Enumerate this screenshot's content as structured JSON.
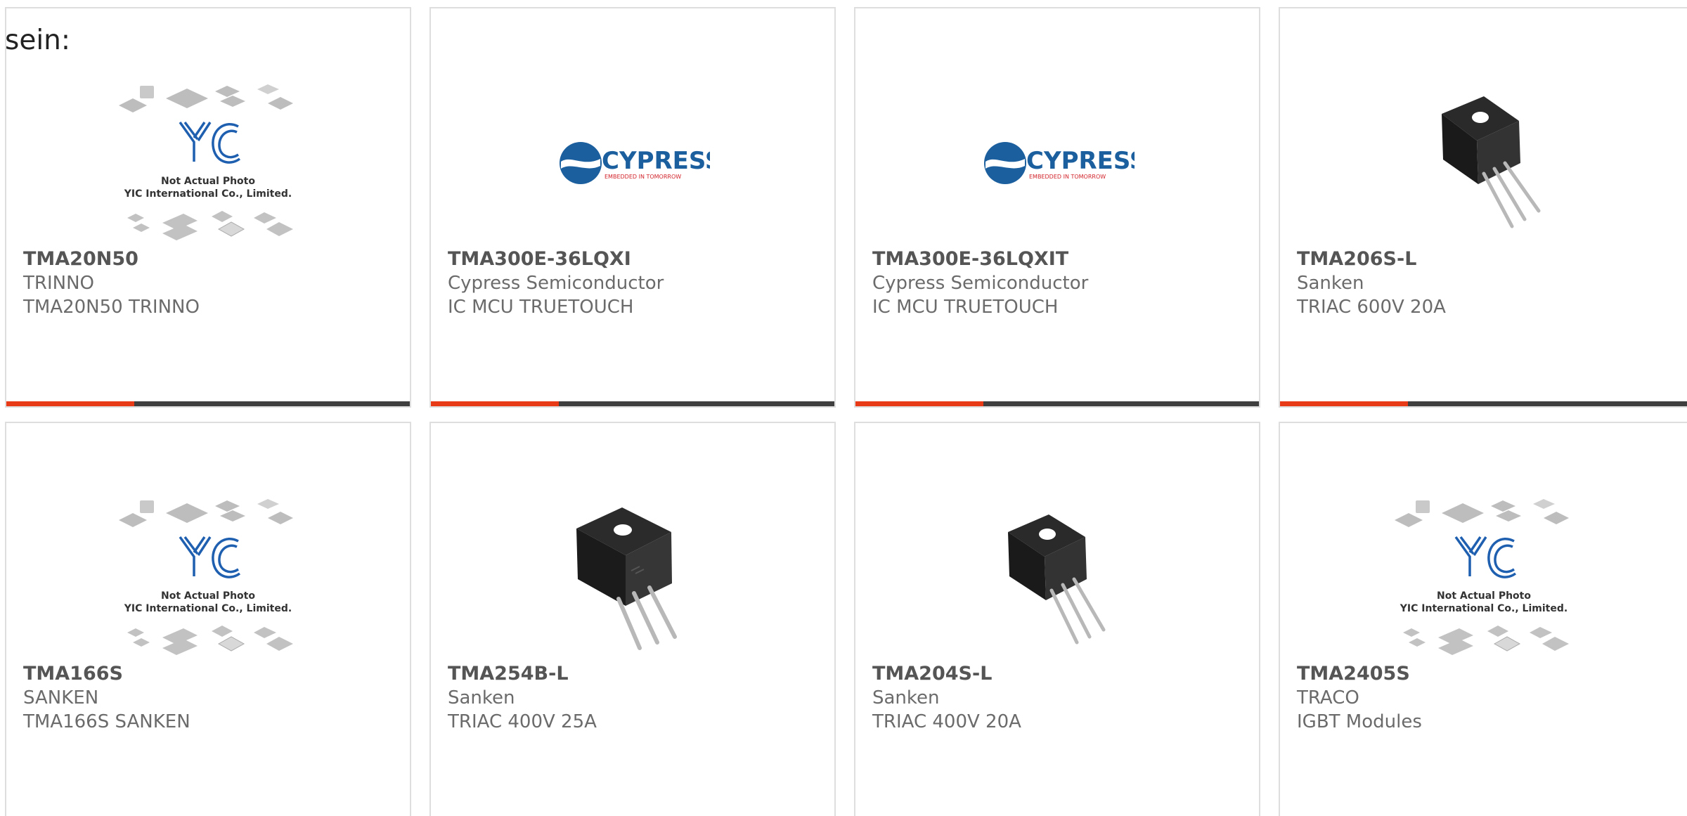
{
  "page": {
    "cut_text": "sein:"
  },
  "products": [
    {
      "part": "TMA20N50",
      "maker": "TRINNO",
      "desc": "TMA20N50 TRINNO",
      "image": "yic-placeholder",
      "image_text_line1": "Not Actual Photo",
      "image_text_line2": "YIC International Co., Limited."
    },
    {
      "part": "TMA300E-36LQXI",
      "maker": "Cypress Semiconductor",
      "desc": "IC MCU TRUETOUCH",
      "image": "cypress-logo",
      "logo_text": "CYPRESS",
      "logo_tagline": "EMBEDDED IN TOMORROW"
    },
    {
      "part": "TMA300E-36LQXIT",
      "maker": "Cypress Semiconductor",
      "desc": "IC MCU TRUETOUCH",
      "image": "cypress-logo",
      "logo_text": "CYPRESS",
      "logo_tagline": "EMBEDDED IN TOMORROW"
    },
    {
      "part": "TMA206S-L",
      "maker": "Sanken",
      "desc": "TRIAC 600V 20A",
      "image": "to220-package"
    },
    {
      "part": "TMA166S",
      "maker": "SANKEN",
      "desc": "TMA166S SANKEN",
      "image": "yic-placeholder",
      "image_text_line1": "Not Actual Photo",
      "image_text_line2": "YIC International Co., Limited."
    },
    {
      "part": "TMA254B-L",
      "maker": "Sanken",
      "desc": "TRIAC 400V 25A",
      "image": "to3p-package"
    },
    {
      "part": "TMA204S-L",
      "maker": "Sanken",
      "desc": "TRIAC 400V 20A",
      "image": "to220-package"
    },
    {
      "part": "TMA2405S",
      "maker": "TRACO",
      "desc": "IGBT Modules",
      "image": "yic-placeholder",
      "image_text_line1": "Not Actual Photo",
      "image_text_line2": "YIC International Co., Limited."
    }
  ],
  "colors": {
    "accent": "#e83a17",
    "bar": "#3f3f3f",
    "border": "#dedede",
    "part_text": "#555555",
    "meta_text": "#6b6b6b",
    "cypress_blue": "#1b5f9e",
    "cypress_red": "#d2232a"
  }
}
